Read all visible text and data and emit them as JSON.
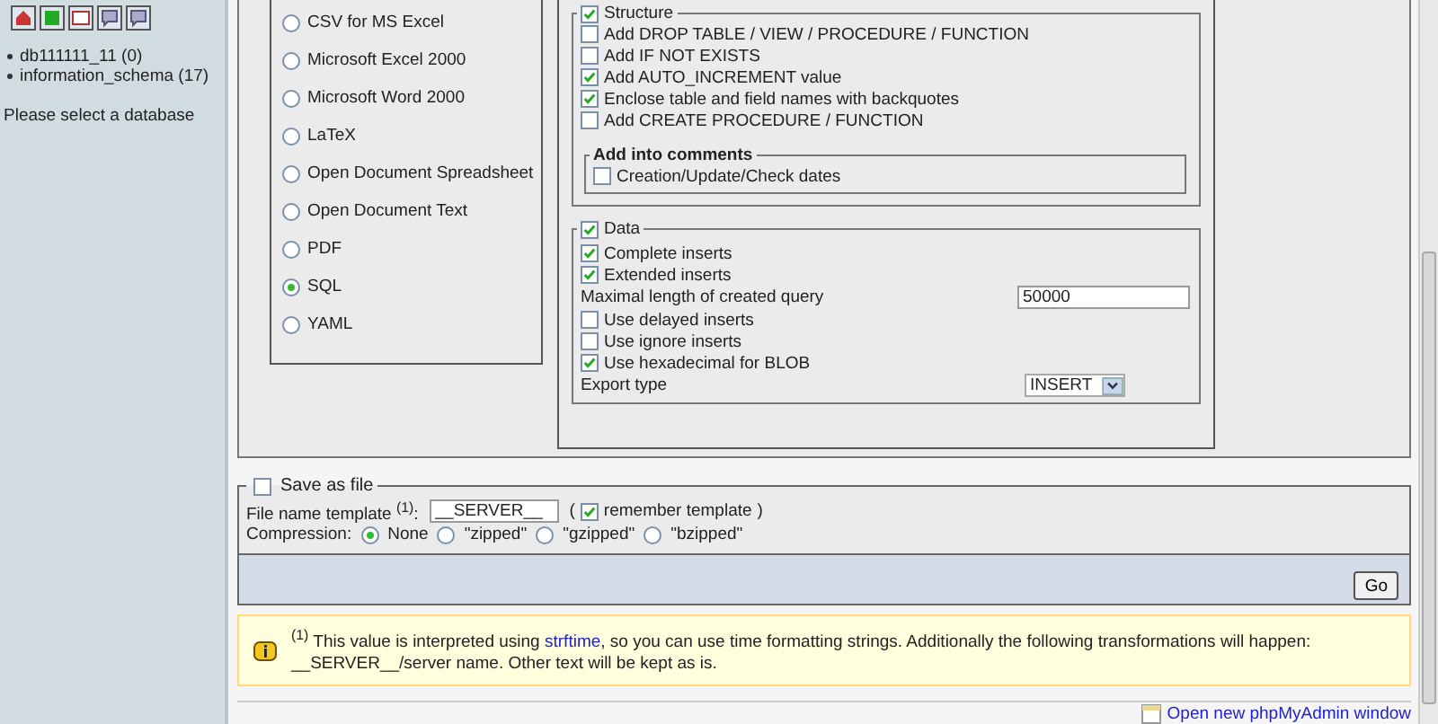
{
  "sidebar": {
    "databases": [
      {
        "name": "db111111_11 (0)"
      },
      {
        "name": "information_schema (17)"
      }
    ],
    "message": "Please select a database"
  },
  "formats": [
    {
      "label": "CSV for MS Excel",
      "selected": false
    },
    {
      "label": "Microsoft Excel 2000",
      "selected": false
    },
    {
      "label": "Microsoft Word 2000",
      "selected": false
    },
    {
      "label": "LaTeX",
      "selected": false
    },
    {
      "label": "Open Document Spreadsheet",
      "selected": false
    },
    {
      "label": "Open Document Text",
      "selected": false
    },
    {
      "label": "PDF",
      "selected": false
    },
    {
      "label": "SQL",
      "selected": true
    },
    {
      "label": "YAML",
      "selected": false
    }
  ],
  "structure": {
    "title": "Structure",
    "checked": true,
    "options": [
      {
        "label": "Add DROP TABLE / VIEW / PROCEDURE / FUNCTION",
        "checked": false
      },
      {
        "label": "Add IF NOT EXISTS",
        "checked": false
      },
      {
        "label": "Add AUTO_INCREMENT value",
        "checked": true
      },
      {
        "label": "Enclose table and field names with backquotes",
        "checked": true
      },
      {
        "label": "Add CREATE PROCEDURE / FUNCTION",
        "checked": false
      }
    ],
    "comments": {
      "title": "Add into comments",
      "options": [
        {
          "label": "Creation/Update/Check dates",
          "checked": false
        }
      ]
    }
  },
  "data": {
    "title": "Data",
    "checked": true,
    "rows": [
      {
        "kind": "checkbox",
        "label": "Complete inserts",
        "checked": true
      },
      {
        "kind": "checkbox",
        "label": "Extended inserts",
        "checked": true
      },
      {
        "kind": "input",
        "label": "Maximal length of created query",
        "value": "50000"
      },
      {
        "kind": "checkbox",
        "label": "Use delayed inserts",
        "checked": false
      },
      {
        "kind": "checkbox",
        "label": "Use ignore inserts",
        "checked": false
      },
      {
        "kind": "checkbox",
        "label": "Use hexadecimal for BLOB",
        "checked": true
      },
      {
        "kind": "select",
        "label": "Export type",
        "value": "INSERT"
      }
    ]
  },
  "save": {
    "title": "Save as file",
    "checked": false,
    "template_label": "File name template $^{(1)}$:",
    "template_value": "__SERVER__",
    "paren_open": "(",
    "remember_label": "remember template",
    "remember_checked": true,
    "paren_close": ")",
    "compression_label": "Compression:",
    "compression": [
      {
        "label": "None",
        "selected": true
      },
      {
        "label": "\"zipped\"",
        "selected": false
      },
      {
        "label": "\"gzipped\"",
        "selected": false
      },
      {
        "label": "\"bzipped\"",
        "selected": false
      }
    ]
  },
  "go": "Go",
  "notice": {
    "before": "$^{(1)}$ This value is interpreted using",
    "link": "strftime",
    "after": ", so you can use time formatting strings. Additionally the following transformations will happen: __SERVER__/server name. Other text will be kept as is."
  },
  "footer_link": "Open new phpMyAdmin window"
}
